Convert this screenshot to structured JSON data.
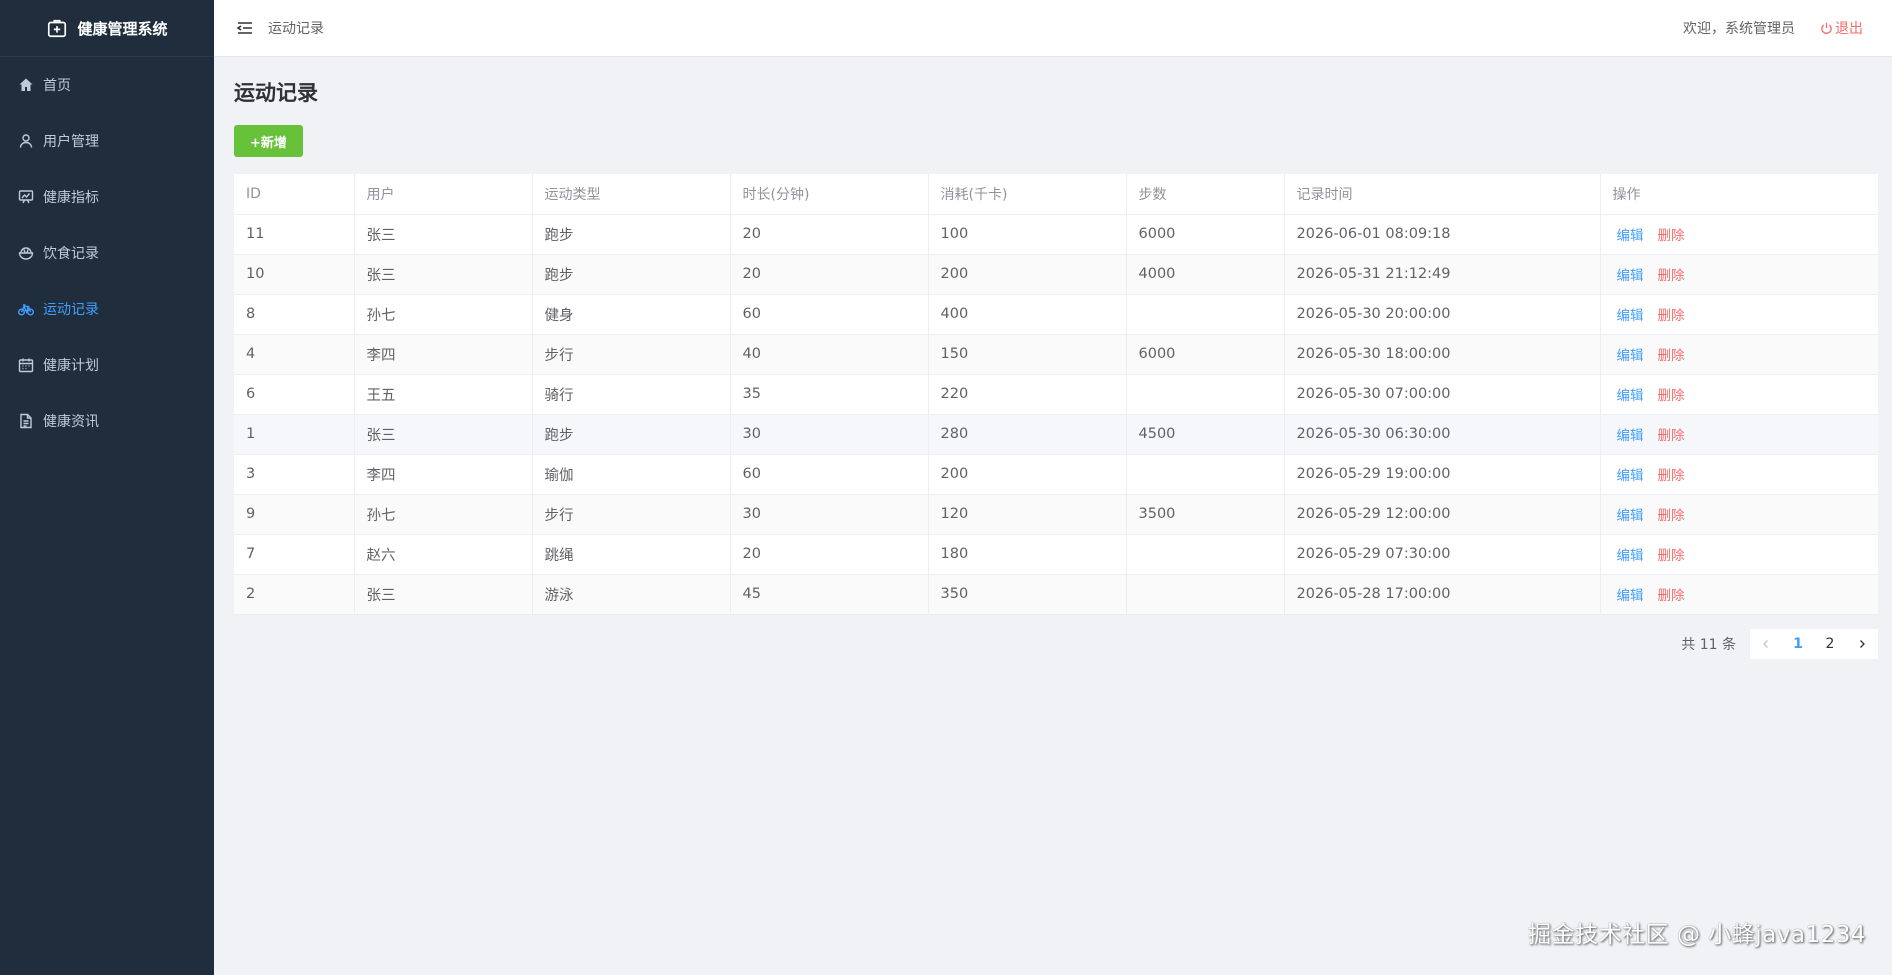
{
  "app": {
    "title": "健康管理系统"
  },
  "sidebar": {
    "items": [
      {
        "label": "首页",
        "icon": "home-icon"
      },
      {
        "label": "用户管理",
        "icon": "user-icon"
      },
      {
        "label": "健康指标",
        "icon": "chart-board-icon"
      },
      {
        "label": "饮食记录",
        "icon": "bowl-icon"
      },
      {
        "label": "运动记录",
        "icon": "bicycle-icon",
        "active": true
      },
      {
        "label": "健康计划",
        "icon": "calendar-icon"
      },
      {
        "label": "健康资讯",
        "icon": "document-icon"
      }
    ]
  },
  "header": {
    "breadcrumb": "运动记录",
    "welcome": "欢迎，系统管理员",
    "logout": "退出"
  },
  "main": {
    "title": "运动记录",
    "add_label": "+新增",
    "table": {
      "columns": [
        "ID",
        "用户",
        "运动类型",
        "时长(分钟)",
        "消耗(千卡)",
        "步数",
        "记录时间",
        "操作"
      ],
      "rows": [
        {
          "id": "11",
          "user": "张三",
          "type": "跑步",
          "duration": "20",
          "calories": "100",
          "steps": "6000",
          "time": "2026-06-01 08:09:18"
        },
        {
          "id": "10",
          "user": "张三",
          "type": "跑步",
          "duration": "20",
          "calories": "200",
          "steps": "4000",
          "time": "2026-05-31 21:12:49"
        },
        {
          "id": "8",
          "user": "孙七",
          "type": "健身",
          "duration": "60",
          "calories": "400",
          "steps": "",
          "time": "2026-05-30 20:00:00"
        },
        {
          "id": "4",
          "user": "李四",
          "type": "步行",
          "duration": "40",
          "calories": "150",
          "steps": "6000",
          "time": "2026-05-30 18:00:00"
        },
        {
          "id": "6",
          "user": "王五",
          "type": "骑行",
          "duration": "35",
          "calories": "220",
          "steps": "",
          "time": "2026-05-30 07:00:00"
        },
        {
          "id": "1",
          "user": "张三",
          "type": "跑步",
          "duration": "30",
          "calories": "280",
          "steps": "4500",
          "time": "2026-05-30 06:30:00"
        },
        {
          "id": "3",
          "user": "李四",
          "type": "瑜伽",
          "duration": "60",
          "calories": "200",
          "steps": "",
          "time": "2026-05-29 19:00:00"
        },
        {
          "id": "9",
          "user": "孙七",
          "type": "步行",
          "duration": "30",
          "calories": "120",
          "steps": "3500",
          "time": "2026-05-29 12:00:00"
        },
        {
          "id": "7",
          "user": "赵六",
          "type": "跳绳",
          "duration": "20",
          "calories": "180",
          "steps": "",
          "time": "2026-05-29 07:30:00"
        },
        {
          "id": "2",
          "user": "张三",
          "type": "游泳",
          "duration": "45",
          "calories": "350",
          "steps": "",
          "time": "2026-05-28 17:00:00"
        }
      ],
      "edit_label": "编辑",
      "delete_label": "删除"
    },
    "pagination": {
      "total_text": "共 11 条",
      "pages": [
        "1",
        "2"
      ],
      "current": "1"
    }
  },
  "watermark": "掘金技术社区 @ 小蜂java1234",
  "colors": {
    "sidebar_bg": "#1f2d3d",
    "accent": "#409eff",
    "danger": "#f56c6c",
    "success": "#67c23a"
  }
}
